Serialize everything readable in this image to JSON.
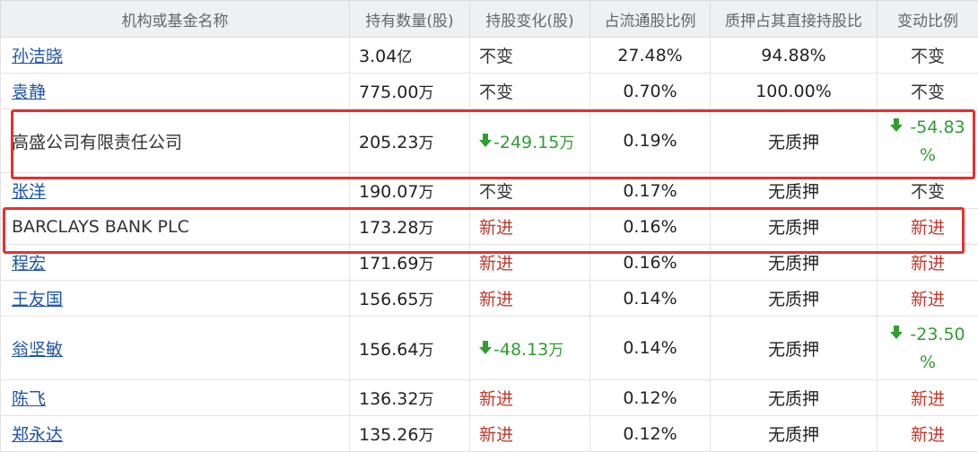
{
  "headers": [
    "机构或基金名称",
    "持有数量(股)",
    "持股变化(股)",
    "占流通股比例",
    "质押占其直接持股比",
    "变动比例"
  ],
  "rows": [
    {
      "name": "孙洁晓",
      "link": true,
      "qty": "3.04",
      "qty_unit": "亿",
      "change": "不变",
      "change_type": "same",
      "ratio": "27.48%",
      "pledge": "94.88%",
      "pct": "不变",
      "pct_type": "same"
    },
    {
      "name": "袁静",
      "link": true,
      "qty": "775.00",
      "qty_unit": "万",
      "change": "不变",
      "change_type": "same",
      "ratio": "0.70%",
      "pledge": "100.00%",
      "pct": "不变",
      "pct_type": "same"
    },
    {
      "name": "高盛公司有限责任公司",
      "link": false,
      "qty": "205.23",
      "qty_unit": "万",
      "change": "-249.15",
      "change_unit": "万",
      "change_type": "down",
      "ratio": "0.19%",
      "pledge": "无质押",
      "pct": "-54.83",
      "pct_suffix": "%",
      "pct_type": "down"
    },
    {
      "name": "张洋",
      "link": true,
      "qty": "190.07",
      "qty_unit": "万",
      "change": "不变",
      "change_type": "same",
      "ratio": "0.17%",
      "pledge": "无质押",
      "pct": "不变",
      "pct_type": "same"
    },
    {
      "name": "BARCLAYS BANK PLC",
      "link": false,
      "qty": "173.28",
      "qty_unit": "万",
      "change": "新进",
      "change_type": "new",
      "ratio": "0.16%",
      "pledge": "无质押",
      "pct": "新进",
      "pct_type": "new"
    },
    {
      "name": "程宏",
      "link": true,
      "qty": "171.69",
      "qty_unit": "万",
      "change": "新进",
      "change_type": "new",
      "ratio": "0.16%",
      "pledge": "无质押",
      "pct": "新进",
      "pct_type": "new"
    },
    {
      "name": "王友国",
      "link": true,
      "qty": "156.65",
      "qty_unit": "万",
      "change": "新进",
      "change_type": "new",
      "ratio": "0.14%",
      "pledge": "无质押",
      "pct": "新进",
      "pct_type": "new"
    },
    {
      "name": "翁坚敏",
      "link": true,
      "qty": "156.64",
      "qty_unit": "万",
      "change": "-48.13",
      "change_unit": "万",
      "change_type": "down",
      "ratio": "0.14%",
      "pledge": "无质押",
      "pct": "-23.50",
      "pct_suffix": "%",
      "pct_type": "down"
    },
    {
      "name": "陈飞",
      "link": true,
      "qty": "136.32",
      "qty_unit": "万",
      "change": "新进",
      "change_type": "new",
      "ratio": "0.12%",
      "pledge": "无质押",
      "pct": "新进",
      "pct_type": "new"
    },
    {
      "name": "郑永达",
      "link": true,
      "qty": "135.26",
      "qty_unit": "万",
      "change": "新进",
      "change_type": "new",
      "ratio": "0.12%",
      "pledge": "无质押",
      "pct": "新进",
      "pct_type": "new"
    }
  ],
  "highlighted_rows": [
    2,
    4
  ],
  "icons": {
    "down_arrow": "arrow-down-icon"
  },
  "colors": {
    "link": "#1f55a8",
    "down": "#2f9e2f",
    "new": "#c0392b",
    "highlight": "#e53030",
    "header_bg": "#eff0f2"
  }
}
